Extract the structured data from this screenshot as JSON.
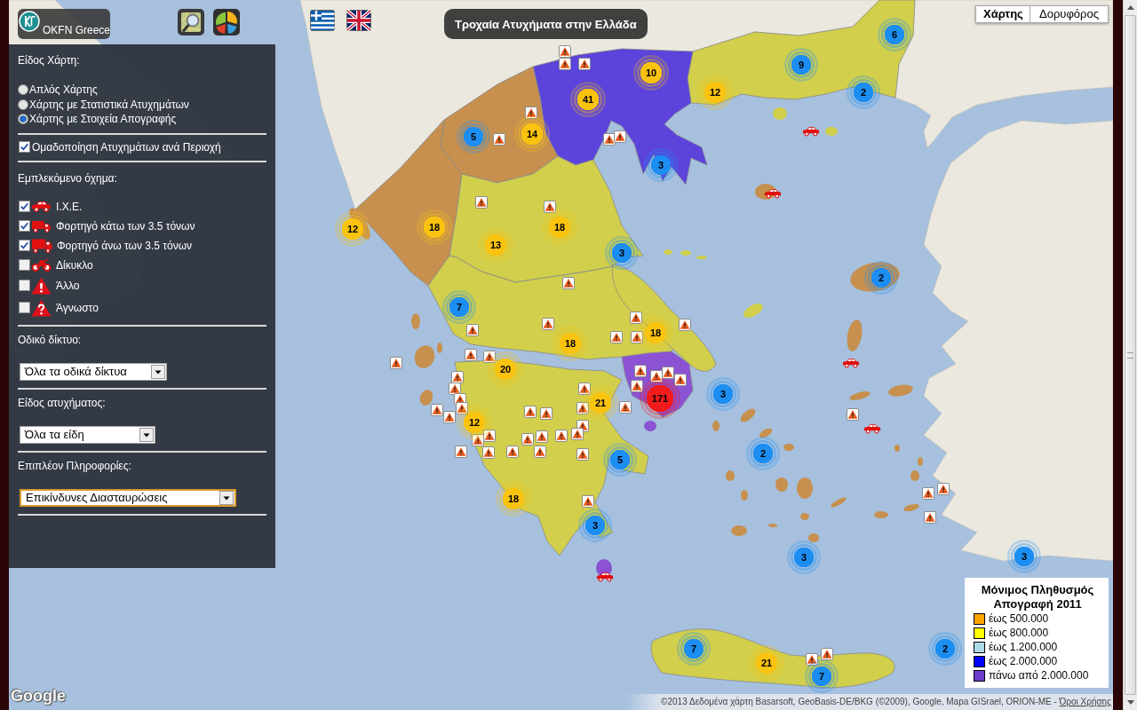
{
  "header": {
    "logo_text": "OKFN Greece",
    "title": "Τροχαία Ατυχήματα στην Ελλάδα"
  },
  "map_type_control": {
    "options": [
      {
        "label": "Χάρτης",
        "selected": true
      },
      {
        "label": "Δορυφόρος",
        "selected": false
      }
    ]
  },
  "sidebar": {
    "map_type": {
      "heading": "Είδος Χάρτη:",
      "options": [
        {
          "label": "Απλός Χάρτης",
          "selected": false
        },
        {
          "label": "Χάρτης με Στατιστικά Ατυχημάτων",
          "selected": false
        },
        {
          "label": "Χάρτης με Στοιχεία Απογραφής",
          "selected": true
        }
      ]
    },
    "grouping": {
      "label": "Ομαδοποίηση Ατυχημάτων ανά Περιοχή",
      "checked": true
    },
    "vehicles": {
      "heading": "Εμπλεκόμενο όχημα:",
      "items": [
        {
          "kind": "car",
          "label": "Ι.Χ.Ε.",
          "checked": true
        },
        {
          "kind": "van",
          "label": "Φορτηγό κάτω των 3.5 τόνων",
          "checked": true
        },
        {
          "kind": "truck",
          "label": "Φορτηγό άνω των 3.5 τόνων",
          "checked": true
        },
        {
          "kind": "motorcycle",
          "label": "Δίκυκλο",
          "checked": false
        },
        {
          "kind": "other",
          "label": "Άλλο",
          "checked": false
        },
        {
          "kind": "unknown",
          "label": "Άγνωστο",
          "checked": false
        }
      ]
    },
    "filters": [
      {
        "heading": "Οδικό δίκτυο:",
        "value": "Όλα τα οδικά δίκτυα",
        "focused": false
      },
      {
        "heading": "Είδος ατυχήματος:",
        "value": "Όλα τα είδη",
        "focused": false
      },
      {
        "heading": "Επιπλέον Πληροφορίες:",
        "value": "Επικίνδυνες Διασταυρώσεις",
        "focused": true
      }
    ]
  },
  "map": {
    "clusters": [
      {
        "count": "6",
        "color": "#1c8ef2"
      },
      {
        "count": "9",
        "color": "#1c8ef2"
      },
      {
        "count": "10",
        "color": "#f9c30f"
      },
      {
        "count": "2",
        "color": "#1c8ef2"
      },
      {
        "count": "12",
        "color": "#f9c30f"
      },
      {
        "count": "41",
        "color": "#f9c30f"
      },
      {
        "count": "14",
        "color": "#f9c30f"
      },
      {
        "count": "5",
        "color": "#1c8ef2"
      },
      {
        "count": "3",
        "color": "#1c8ef2"
      },
      {
        "count": "12",
        "color": "#f9c30f"
      },
      {
        "count": "18",
        "color": "#f9c30f"
      },
      {
        "count": "18",
        "color": "#f9c30f"
      },
      {
        "count": "13",
        "color": "#f9c30f"
      },
      {
        "count": "3",
        "color": "#1c8ef2"
      },
      {
        "count": "2",
        "color": "#1c8ef2"
      },
      {
        "count": "7",
        "color": "#1c8ef2"
      },
      {
        "count": "18",
        "color": "#f9c30f"
      },
      {
        "count": "18",
        "color": "#f9c30f"
      },
      {
        "count": "20",
        "color": "#f9c30f"
      },
      {
        "count": "3",
        "color": "#1c8ef2"
      },
      {
        "count": "171",
        "color": "#f21b1b"
      },
      {
        "count": "21",
        "color": "#f9c30f"
      },
      {
        "count": "12",
        "color": "#f9c30f"
      },
      {
        "count": "2",
        "color": "#1c8ef2"
      },
      {
        "count": "5",
        "color": "#1c8ef2"
      },
      {
        "count": "18",
        "color": "#f9c30f"
      },
      {
        "count": "3",
        "color": "#1c8ef2"
      },
      {
        "count": "3",
        "color": "#1c8ef2"
      },
      {
        "count": "3",
        "color": "#1c8ef2"
      },
      {
        "count": "2",
        "color": "#1c8ef2"
      },
      {
        "count": "7",
        "color": "#1c8ef2"
      },
      {
        "count": "21",
        "color": "#f9c30f"
      },
      {
        "count": "7",
        "color": "#1c8ef2"
      }
    ]
  },
  "legend": {
    "title": "Μόνιμος Πληθυσμός Απογραφή 2011",
    "items": [
      {
        "label": "έως 500.000",
        "color": "#ffa500"
      },
      {
        "label": "έως 800.000",
        "color": "#ffff00"
      },
      {
        "label": "έως 1.200.000",
        "color": "#add8e6"
      },
      {
        "label": "έως 2.000.000",
        "color": "#0000ff"
      },
      {
        "label": "πάνω από 2.000.000",
        "color": "#6a3dcc"
      }
    ]
  },
  "footer": {
    "logo": "Google",
    "attribution": "©2013 Δεδομένα χάρτη Basarsoft, GeoBasis-DE/BKG (©2009), Google, Mapa GISrael, ORION-ME -",
    "terms_link": "Όροι Χρήσης"
  }
}
